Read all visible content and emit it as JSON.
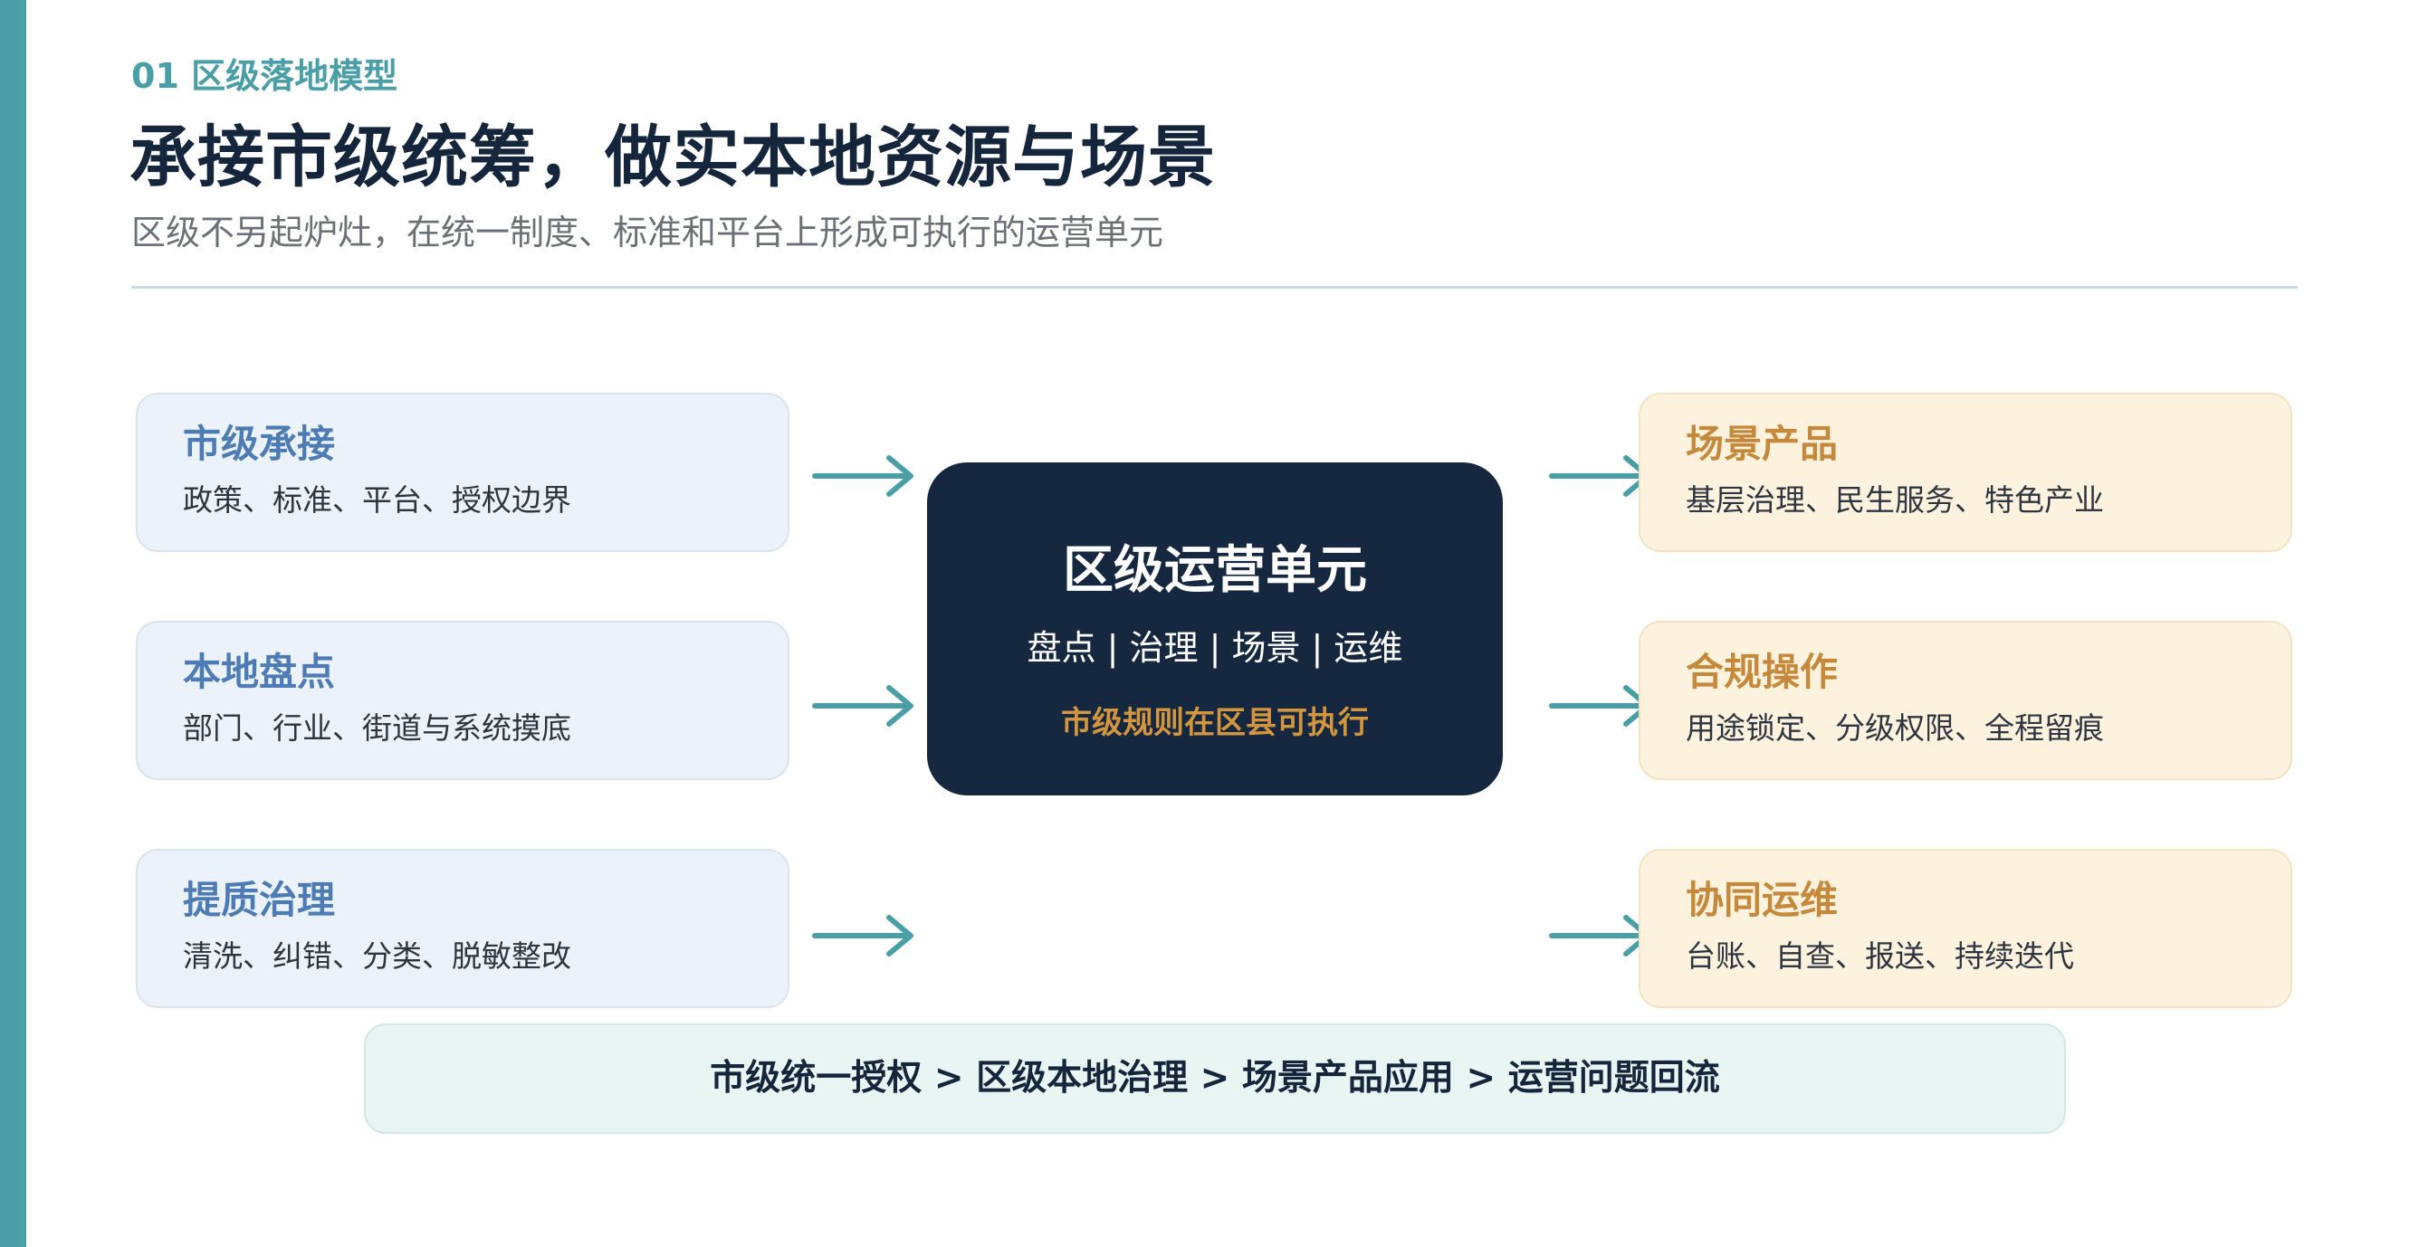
{
  "header": {
    "eyebrow": "01 区级落地模型",
    "title": "承接市级统筹，做实本地资源与场景",
    "subtitle": "区级不另起炉灶，在统一制度、标准和平台上形成可执行的运营单元"
  },
  "left_cards": [
    {
      "title": "市级承接",
      "desc": "政策、标准、平台、授权边界"
    },
    {
      "title": "本地盘点",
      "desc": "部门、行业、街道与系统摸底"
    },
    {
      "title": "提质治理",
      "desc": "清洗、纠错、分类、脱敏整改"
    }
  ],
  "center": {
    "title": "区级运营单元",
    "subtitle": "盘点 | 治理 | 场景 | 运维",
    "note": "市级规则在区县可执行"
  },
  "right_cards": [
    {
      "title": "场景产品",
      "desc": "基层治理、民生服务、特色产业"
    },
    {
      "title": "合规操作",
      "desc": "用途锁定、分级权限、全程留痕"
    },
    {
      "title": "协同运维",
      "desc": "台账、自查、报送、持续迭代"
    }
  ],
  "flow": {
    "text": "市级统一授权 > 区级本地治理 > 场景产品应用 > 运营问题回流"
  },
  "colors": {
    "accent_teal": "#4a9ea6",
    "navy": "#15283f",
    "left_card_bg": "#ebf2f9",
    "left_title": "#4d7bb3",
    "right_card_bg": "#fcf2de",
    "right_title": "#c4893b",
    "gold_note": "#d3963f",
    "flow_bg": "#e9f5f2"
  },
  "icons": {
    "arrow": "right-arrow-icon"
  }
}
